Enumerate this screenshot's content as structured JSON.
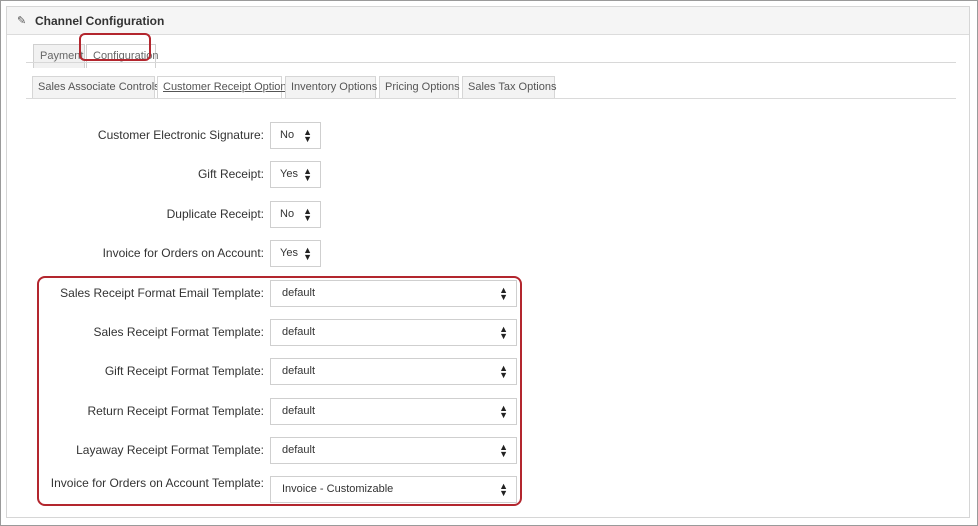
{
  "panel": {
    "title": "Channel Configuration",
    "icon": "edit-icon"
  },
  "top_tabs": [
    {
      "label": "Payment"
    },
    {
      "label": "Configuration"
    }
  ],
  "sub_tabs": [
    {
      "label": "Sales Associate Controls"
    },
    {
      "label": "Customer Receipt Options"
    },
    {
      "label": "Inventory Options"
    },
    {
      "label": "Pricing Options"
    },
    {
      "label": "Sales Tax Options"
    }
  ],
  "fields": [
    {
      "label": "Customer Electronic Signature:",
      "value": "No"
    },
    {
      "label": "Gift Receipt:",
      "value": "Yes"
    },
    {
      "label": "Duplicate Receipt:",
      "value": "No"
    },
    {
      "label": "Invoice for Orders on Account:",
      "value": "Yes"
    }
  ],
  "templates": [
    {
      "label": "Sales Receipt Format Email Template:",
      "value": "default"
    },
    {
      "label": "Sales Receipt Format Template:",
      "value": "default"
    },
    {
      "label": "Gift Receipt Format Template:",
      "value": "default"
    },
    {
      "label": "Return Receipt Format Template:",
      "value": "default"
    },
    {
      "label": "Layaway Receipt Format Template:",
      "value": "default"
    },
    {
      "label": "Invoice for Orders on Account Template:",
      "value": "Invoice - Customizable"
    }
  ],
  "colors": {
    "highlight": "#b3262e"
  }
}
